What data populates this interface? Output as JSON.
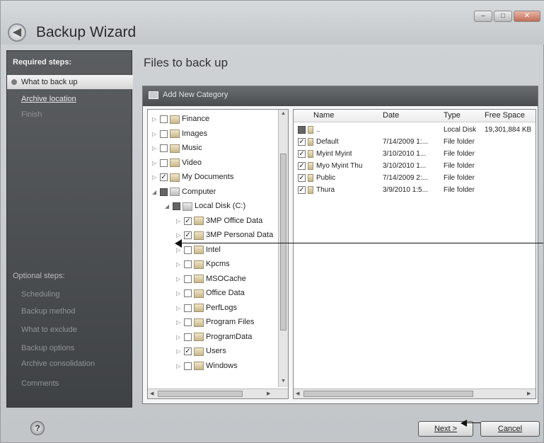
{
  "window": {
    "title": "Backup Wizard",
    "controls": [
      "–",
      "□",
      "✕"
    ]
  },
  "sidebar": {
    "required_heading": "Required steps:",
    "required_items": [
      {
        "label": "What to back up",
        "state": "active"
      },
      {
        "label": "Archive location",
        "state": "link"
      },
      {
        "label": "Finish",
        "state": "muted"
      }
    ],
    "optional_heading": "Optional steps:",
    "optional_items": [
      {
        "label": "Scheduling"
      },
      {
        "label": "Backup method"
      },
      {
        "label": "What to exclude"
      },
      {
        "label": "Backup options"
      },
      {
        "label": "Archive consolidation"
      },
      {
        "label": "Comments"
      }
    ]
  },
  "main": {
    "page_title": "Files to back up",
    "toolbar_label": "Add New Category"
  },
  "tree": {
    "items": [
      {
        "label": "Finance",
        "level": 0,
        "expander": "▷",
        "check": "",
        "icon": "folder"
      },
      {
        "label": "Images",
        "level": 0,
        "expander": "▷",
        "check": "",
        "icon": "folder"
      },
      {
        "label": "Music",
        "level": 0,
        "expander": "▷",
        "check": "",
        "icon": "folder"
      },
      {
        "label": "Video",
        "level": 0,
        "expander": "▷",
        "check": "",
        "icon": "folder"
      },
      {
        "label": "My Documents",
        "level": 0,
        "expander": "▷",
        "check": "✓",
        "icon": "folder"
      },
      {
        "label": "Computer",
        "level": 0,
        "expander": "◢",
        "check": "partial",
        "icon": "computer"
      },
      {
        "label": "Local Disk (C:)",
        "level": 1,
        "expander": "◢",
        "check": "partial",
        "icon": "disk"
      },
      {
        "label": "3MP Office Data",
        "level": 2,
        "expander": "▷",
        "check": "✓",
        "icon": "folder"
      },
      {
        "label": "3MP Personal Data",
        "level": 2,
        "expander": "▷",
        "check": "✓",
        "icon": "folder"
      },
      {
        "label": "Intel",
        "level": 2,
        "expander": "▷",
        "check": "",
        "icon": "folder"
      },
      {
        "label": "Kpcms",
        "level": 2,
        "expander": "▷",
        "check": "",
        "icon": "folder"
      },
      {
        "label": "MSOCache",
        "level": 2,
        "expander": "▷",
        "check": "",
        "icon": "folder"
      },
      {
        "label": "Office Data",
        "level": 2,
        "expander": "▷",
        "check": "",
        "icon": "folder"
      },
      {
        "label": "PerfLogs",
        "level": 2,
        "expander": "▷",
        "check": "",
        "icon": "folder"
      },
      {
        "label": "Program Files",
        "level": 2,
        "expander": "▷",
        "check": "",
        "icon": "folder"
      },
      {
        "label": "ProgramData",
        "level": 2,
        "expander": "▷",
        "check": "",
        "icon": "folder"
      },
      {
        "label": "Users",
        "level": 2,
        "expander": "▷",
        "check": "✓",
        "icon": "folder"
      },
      {
        "label": "Windows",
        "level": 2,
        "expander": "▷",
        "check": "",
        "icon": "folder"
      }
    ]
  },
  "list": {
    "columns": [
      "Name",
      "Date",
      "Type",
      "Free Space"
    ],
    "rows": [
      {
        "name": "..",
        "date": "",
        "type": "Local Disk",
        "free": "19,301,884 KB",
        "check": "partial"
      },
      {
        "name": "Default",
        "date": "7/14/2009 1:...",
        "type": "File folder",
        "free": "",
        "check": "✓"
      },
      {
        "name": "Myint Myint",
        "date": "3/10/2010 1...",
        "type": "File folder",
        "free": "",
        "check": "✓"
      },
      {
        "name": "Myo Myint Thu",
        "date": "3/10/2010 1...",
        "type": "File folder",
        "free": "",
        "check": "✓"
      },
      {
        "name": "Public",
        "date": "7/14/2009 2:...",
        "type": "File folder",
        "free": "",
        "check": "✓"
      },
      {
        "name": "Thura",
        "date": "3/9/2010 1:5...",
        "type": "File folder",
        "free": "",
        "check": "✓"
      }
    ]
  },
  "footer": {
    "help": "?",
    "next_label": "Next >",
    "cancel_label": "Cancel"
  }
}
